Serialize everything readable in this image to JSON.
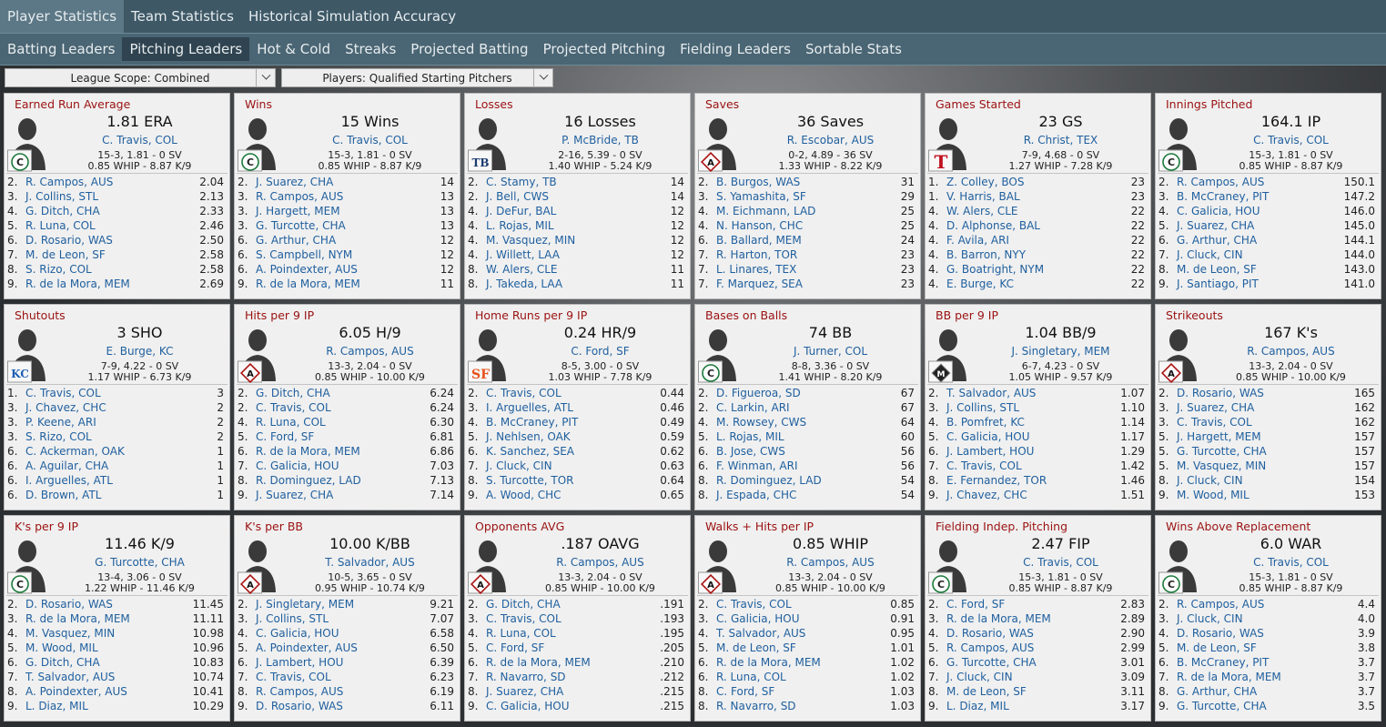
{
  "tabs_top": [
    {
      "label": "Player Statistics",
      "active": true
    },
    {
      "label": "Team Statistics",
      "active": false
    },
    {
      "label": "Historical Simulation Accuracy",
      "active": false
    }
  ],
  "tabs_sub": [
    {
      "label": "Batting Leaders",
      "active": false
    },
    {
      "label": "Pitching Leaders",
      "active": true
    },
    {
      "label": "Hot & Cold",
      "active": false
    },
    {
      "label": "Streaks",
      "active": false
    },
    {
      "label": "Projected Batting",
      "active": false
    },
    {
      "label": "Projected Pitching",
      "active": false
    },
    {
      "label": "Fielding Leaders",
      "active": false
    },
    {
      "label": "Sortable Stats",
      "active": false
    }
  ],
  "filters": {
    "scope": "League Scope: Combined",
    "players": "Players: Qualified Starting Pitchers"
  },
  "panels": [
    {
      "title": "Earned Run Average",
      "leader_value": "1.81 ERA",
      "leader_name": "C. Travis, COL",
      "leader_line1": "15-3, 1.81 - 0 SV",
      "leader_line2": "0.85 WHIP - 8.87 K/9",
      "logo": "C",
      "rows": [
        [
          "2.",
          "R. Campos, AUS",
          "2.04"
        ],
        [
          "3.",
          "J. Collins, STL",
          "2.13"
        ],
        [
          "4.",
          "G. Ditch, CHA",
          "2.33"
        ],
        [
          "5.",
          "R. Luna, COL",
          "2.46"
        ],
        [
          "6.",
          "D. Rosario, WAS",
          "2.50"
        ],
        [
          "7.",
          "M. de Leon, SF",
          "2.58"
        ],
        [
          "8.",
          "S. Rizo, COL",
          "2.58"
        ],
        [
          "9.",
          "R. de la Mora, MEM",
          "2.69"
        ]
      ]
    },
    {
      "title": "Wins",
      "leader_value": "15 Wins",
      "leader_name": "C. Travis, COL",
      "leader_line1": "15-3, 1.81 - 0 SV",
      "leader_line2": "0.85 WHIP - 8.87 K/9",
      "logo": "C",
      "rows": [
        [
          "2.",
          "J. Suarez, CHA",
          "14"
        ],
        [
          "3.",
          "R. Campos, AUS",
          "13"
        ],
        [
          "3.",
          "J. Hargett, MEM",
          "13"
        ],
        [
          "3.",
          "G. Turcotte, CHA",
          "13"
        ],
        [
          "6.",
          "G. Arthur, CHA",
          "12"
        ],
        [
          "6.",
          "S. Campbell, NYM",
          "12"
        ],
        [
          "6.",
          "A. Poindexter, AUS",
          "12"
        ],
        [
          "9.",
          "R. de la Mora, MEM",
          "11"
        ]
      ]
    },
    {
      "title": "Losses",
      "leader_value": "16 Losses",
      "leader_name": "P. McBride, TB",
      "leader_line1": "2-16, 5.39 - 0 SV",
      "leader_line2": "1.40 WHIP - 5.24 K/9",
      "logo": "TB",
      "rows": [
        [
          "2.",
          "C. Stamy, TB",
          "14"
        ],
        [
          "2.",
          "J. Bell, CWS",
          "14"
        ],
        [
          "4.",
          "J. DeFur, BAL",
          "12"
        ],
        [
          "4.",
          "L. Rojas, MIL",
          "12"
        ],
        [
          "4.",
          "M. Vasquez, MIN",
          "12"
        ],
        [
          "4.",
          "J. Willett, LAA",
          "12"
        ],
        [
          "8.",
          "W. Alers, CLE",
          "11"
        ],
        [
          "8.",
          "J. Takeda, LAA",
          "11"
        ]
      ]
    },
    {
      "title": "Saves",
      "leader_value": "36 Saves",
      "leader_name": "R. Escobar, AUS",
      "leader_line1": "0-2, 4.89 - 36 SV",
      "leader_line2": "1.33 WHIP - 8.22 K/9",
      "logo": "A",
      "rows": [
        [
          "2.",
          "B. Burgos, WAS",
          "31"
        ],
        [
          "3.",
          "S. Yamashita, SF",
          "29"
        ],
        [
          "4.",
          "M. Eichmann, LAD",
          "25"
        ],
        [
          "4.",
          "N. Hanson, CHC",
          "25"
        ],
        [
          "6.",
          "B. Ballard, MEM",
          "24"
        ],
        [
          "7.",
          "R. Harton, TOR",
          "23"
        ],
        [
          "7.",
          "L. Linares, TEX",
          "23"
        ],
        [
          "7.",
          "F. Marquez, SEA",
          "23"
        ]
      ]
    },
    {
      "title": "Games Started",
      "leader_value": "23 GS",
      "leader_name": "R. Christ, TEX",
      "leader_line1": "7-9, 4.68 - 0 SV",
      "leader_line2": "1.27 WHIP - 7.28 K/9",
      "logo": "T",
      "rows": [
        [
          "1.",
          "Z. Colley, BOS",
          "23"
        ],
        [
          "1.",
          "V. Harris, BAL",
          "23"
        ],
        [
          "4.",
          "W. Alers, CLE",
          "22"
        ],
        [
          "4.",
          "D. Alphonse, BAL",
          "22"
        ],
        [
          "4.",
          "F. Avila, ARI",
          "22"
        ],
        [
          "4.",
          "B. Barron, NYY",
          "22"
        ],
        [
          "4.",
          "G. Boatright, NYM",
          "22"
        ],
        [
          "4.",
          "E. Burge, KC",
          "22"
        ]
      ]
    },
    {
      "title": "Innings Pitched",
      "leader_value": "164.1 IP",
      "leader_name": "C. Travis, COL",
      "leader_line1": "15-3, 1.81 - 0 SV",
      "leader_line2": "0.85 WHIP - 8.87 K/9",
      "logo": "C",
      "rows": [
        [
          "2.",
          "R. Campos, AUS",
          "150.1"
        ],
        [
          "3.",
          "B. McCraney, PIT",
          "147.2"
        ],
        [
          "4.",
          "C. Galicia, HOU",
          "146.0"
        ],
        [
          "5.",
          "J. Suarez, CHA",
          "145.0"
        ],
        [
          "6.",
          "G. Arthur, CHA",
          "144.1"
        ],
        [
          "7.",
          "J. Cluck, CIN",
          "144.0"
        ],
        [
          "8.",
          "M. de Leon, SF",
          "143.0"
        ],
        [
          "9.",
          "J. Santiago, PIT",
          "141.0"
        ]
      ]
    },
    {
      "title": "Shutouts",
      "leader_value": "3 SHO",
      "leader_name": "E. Burge, KC",
      "leader_line1": "7-9, 4.22 - 0 SV",
      "leader_line2": "1.17 WHIP - 6.73 K/9",
      "logo": "KC",
      "rows": [
        [
          "1.",
          "C. Travis, COL",
          "3"
        ],
        [
          "3.",
          "J. Chavez, CHC",
          "2"
        ],
        [
          "3.",
          "P. Keene, ARI",
          "2"
        ],
        [
          "3.",
          "S. Rizo, COL",
          "2"
        ],
        [
          "6.",
          "C. Ackerman, OAK",
          "1"
        ],
        [
          "6.",
          "A. Aguilar, CHA",
          "1"
        ],
        [
          "6.",
          "I. Arguelles, ATL",
          "1"
        ],
        [
          "6.",
          "D. Brown, ATL",
          "1"
        ]
      ]
    },
    {
      "title": "Hits per 9 IP",
      "leader_value": "6.05 H/9",
      "leader_name": "R. Campos, AUS",
      "leader_line1": "13-3, 2.04 - 0 SV",
      "leader_line2": "0.85 WHIP - 10.00 K/9",
      "logo": "A",
      "rows": [
        [
          "2.",
          "G. Ditch, CHA",
          "6.24"
        ],
        [
          "2.",
          "C. Travis, COL",
          "6.24"
        ],
        [
          "4.",
          "R. Luna, COL",
          "6.30"
        ],
        [
          "5.",
          "C. Ford, SF",
          "6.81"
        ],
        [
          "6.",
          "R. de la Mora, MEM",
          "6.86"
        ],
        [
          "7.",
          "C. Galicia, HOU",
          "7.03"
        ],
        [
          "8.",
          "R. Dominguez, LAD",
          "7.13"
        ],
        [
          "9.",
          "J. Suarez, CHA",
          "7.14"
        ]
      ]
    },
    {
      "title": "Home Runs per 9 IP",
      "leader_value": "0.24 HR/9",
      "leader_name": "C. Ford, SF",
      "leader_line1": "8-5, 3.00 - 0 SV",
      "leader_line2": "1.03 WHIP - 7.78 K/9",
      "logo": "SF",
      "rows": [
        [
          "2.",
          "C. Travis, COL",
          "0.44"
        ],
        [
          "3.",
          "I. Arguelles, ATL",
          "0.46"
        ],
        [
          "4.",
          "B. McCraney, PIT",
          "0.49"
        ],
        [
          "5.",
          "J. Nehlsen, OAK",
          "0.59"
        ],
        [
          "6.",
          "K. Sanchez, SEA",
          "0.62"
        ],
        [
          "7.",
          "J. Cluck, CIN",
          "0.63"
        ],
        [
          "8.",
          "S. Turcotte, TOR",
          "0.64"
        ],
        [
          "9.",
          "A. Wood, CHC",
          "0.65"
        ]
      ]
    },
    {
      "title": "Bases on Balls",
      "leader_value": "74 BB",
      "leader_name": "J. Turner, COL",
      "leader_line1": "8-8, 3.36 - 0 SV",
      "leader_line2": "1.41 WHIP - 8.20 K/9",
      "logo": "C",
      "rows": [
        [
          "2.",
          "D. Figueroa, SD",
          "67"
        ],
        [
          "2.",
          "C. Larkin, ARI",
          "67"
        ],
        [
          "4.",
          "M. Rowsey, CWS",
          "64"
        ],
        [
          "5.",
          "L. Rojas, MIL",
          "60"
        ],
        [
          "6.",
          "B. Jose, CWS",
          "56"
        ],
        [
          "6.",
          "F. Winman, ARI",
          "56"
        ],
        [
          "8.",
          "R. Dominguez, LAD",
          "54"
        ],
        [
          "8.",
          "J. Espada, CHC",
          "54"
        ]
      ]
    },
    {
      "title": "BB per 9 IP",
      "leader_value": "1.04 BB/9",
      "leader_name": "J. Singletary, MEM",
      "leader_line1": "6-7, 4.23 - 0 SV",
      "leader_line2": "1.05 WHIP - 9.57 K/9",
      "logo": "M",
      "rows": [
        [
          "2.",
          "T. Salvador, AUS",
          "1.07"
        ],
        [
          "3.",
          "J. Collins, STL",
          "1.10"
        ],
        [
          "4.",
          "B. Pomfret, KC",
          "1.14"
        ],
        [
          "5.",
          "C. Galicia, HOU",
          "1.17"
        ],
        [
          "6.",
          "J. Lambert, HOU",
          "1.29"
        ],
        [
          "7.",
          "C. Travis, COL",
          "1.42"
        ],
        [
          "8.",
          "E. Fernandez, TOR",
          "1.46"
        ],
        [
          "9.",
          "J. Chavez, CHC",
          "1.51"
        ]
      ]
    },
    {
      "title": "Strikeouts",
      "leader_value": "167 K's",
      "leader_name": "R. Campos, AUS",
      "leader_line1": "13-3, 2.04 - 0 SV",
      "leader_line2": "0.85 WHIP - 10.00 K/9",
      "logo": "A",
      "rows": [
        [
          "2.",
          "D. Rosario, WAS",
          "165"
        ],
        [
          "3.",
          "J. Suarez, CHA",
          "162"
        ],
        [
          "3.",
          "C. Travis, COL",
          "162"
        ],
        [
          "5.",
          "J. Hargett, MEM",
          "157"
        ],
        [
          "5.",
          "G. Turcotte, CHA",
          "157"
        ],
        [
          "5.",
          "M. Vasquez, MIN",
          "157"
        ],
        [
          "8.",
          "J. Cluck, CIN",
          "154"
        ],
        [
          "9.",
          "M. Wood, MIL",
          "153"
        ]
      ]
    },
    {
      "title": "K's per 9 IP",
      "leader_value": "11.46 K/9",
      "leader_name": "G. Turcotte, CHA",
      "leader_line1": "13-4, 3.06 - 0 SV",
      "leader_line2": "1.22 WHIP - 11.46 K/9",
      "logo": "C",
      "rows": [
        [
          "2.",
          "D. Rosario, WAS",
          "11.45"
        ],
        [
          "3.",
          "R. de la Mora, MEM",
          "11.11"
        ],
        [
          "4.",
          "M. Vasquez, MIN",
          "10.98"
        ],
        [
          "5.",
          "M. Wood, MIL",
          "10.96"
        ],
        [
          "6.",
          "G. Ditch, CHA",
          "10.83"
        ],
        [
          "7.",
          "T. Salvador, AUS",
          "10.74"
        ],
        [
          "8.",
          "A. Poindexter, AUS",
          "10.41"
        ],
        [
          "9.",
          "L. Diaz, MIL",
          "10.29"
        ]
      ]
    },
    {
      "title": "K's per BB",
      "leader_value": "10.00 K/BB",
      "leader_name": "T. Salvador, AUS",
      "leader_line1": "10-5, 3.65 - 0 SV",
      "leader_line2": "0.95 WHIP - 10.74 K/9",
      "logo": "A",
      "rows": [
        [
          "2.",
          "J. Singletary, MEM",
          "9.21"
        ],
        [
          "3.",
          "J. Collins, STL",
          "7.07"
        ],
        [
          "4.",
          "C. Galicia, HOU",
          "6.58"
        ],
        [
          "5.",
          "A. Poindexter, AUS",
          "6.50"
        ],
        [
          "6.",
          "J. Lambert, HOU",
          "6.39"
        ],
        [
          "7.",
          "C. Travis, COL",
          "6.23"
        ],
        [
          "8.",
          "R. Campos, AUS",
          "6.19"
        ],
        [
          "9.",
          "D. Rosario, WAS",
          "6.11"
        ]
      ]
    },
    {
      "title": "Opponents AVG",
      "leader_value": ".187 OAVG",
      "leader_name": "R. Campos, AUS",
      "leader_line1": "13-3, 2.04 - 0 SV",
      "leader_line2": "0.85 WHIP - 10.00 K/9",
      "logo": "A",
      "rows": [
        [
          "2.",
          "G. Ditch, CHA",
          ".191"
        ],
        [
          "3.",
          "C. Travis, COL",
          ".193"
        ],
        [
          "4.",
          "R. Luna, COL",
          ".195"
        ],
        [
          "5.",
          "C. Ford, SF",
          ".205"
        ],
        [
          "6.",
          "R. de la Mora, MEM",
          ".210"
        ],
        [
          "7.",
          "R. Navarro, SD",
          ".212"
        ],
        [
          "8.",
          "J. Suarez, CHA",
          ".215"
        ],
        [
          "9.",
          "C. Galicia, HOU",
          ".215"
        ]
      ]
    },
    {
      "title": "Walks + Hits per IP",
      "leader_value": "0.85 WHIP",
      "leader_name": "R. Campos, AUS",
      "leader_line1": "13-3, 2.04 - 0 SV",
      "leader_line2": "0.85 WHIP - 10.00 K/9",
      "logo": "A",
      "rows": [
        [
          "2.",
          "C. Travis, COL",
          "0.85"
        ],
        [
          "3.",
          "C. Galicia, HOU",
          "0.91"
        ],
        [
          "4.",
          "T. Salvador, AUS",
          "0.95"
        ],
        [
          "5.",
          "M. de Leon, SF",
          "1.01"
        ],
        [
          "6.",
          "R. de la Mora, MEM",
          "1.02"
        ],
        [
          "6.",
          "R. Luna, COL",
          "1.02"
        ],
        [
          "8.",
          "C. Ford, SF",
          "1.03"
        ],
        [
          "8.",
          "R. Navarro, SD",
          "1.03"
        ]
      ]
    },
    {
      "title": "Fielding Indep. Pitching",
      "leader_value": "2.47 FIP",
      "leader_name": "C. Travis, COL",
      "leader_line1": "15-3, 1.81 - 0 SV",
      "leader_line2": "0.85 WHIP - 8.87 K/9",
      "logo": "C",
      "rows": [
        [
          "2.",
          "C. Ford, SF",
          "2.83"
        ],
        [
          "3.",
          "R. de la Mora, MEM",
          "2.89"
        ],
        [
          "4.",
          "D. Rosario, WAS",
          "2.90"
        ],
        [
          "5.",
          "R. Campos, AUS",
          "2.99"
        ],
        [
          "6.",
          "G. Turcotte, CHA",
          "3.01"
        ],
        [
          "7.",
          "J. Cluck, CIN",
          "3.09"
        ],
        [
          "8.",
          "M. de Leon, SF",
          "3.11"
        ],
        [
          "9.",
          "L. Diaz, MIL",
          "3.17"
        ]
      ]
    },
    {
      "title": "Wins Above Replacement",
      "leader_value": "6.0 WAR",
      "leader_name": "C. Travis, COL",
      "leader_line1": "15-3, 1.81 - 0 SV",
      "leader_line2": "0.85 WHIP - 8.87 K/9",
      "logo": "C",
      "rows": [
        [
          "2.",
          "R. Campos, AUS",
          "4.4"
        ],
        [
          "3.",
          "J. Cluck, CIN",
          "4.0"
        ],
        [
          "4.",
          "D. Rosario, WAS",
          "3.9"
        ],
        [
          "5.",
          "M. de Leon, SF",
          "3.8"
        ],
        [
          "6.",
          "B. McCraney, PIT",
          "3.7"
        ],
        [
          "7.",
          "R. de la Mora, MEM",
          "3.7"
        ],
        [
          "8.",
          "G. Arthur, CHA",
          "3.7"
        ],
        [
          "9.",
          "G. Turcotte, CHA",
          "3.5"
        ]
      ]
    }
  ]
}
